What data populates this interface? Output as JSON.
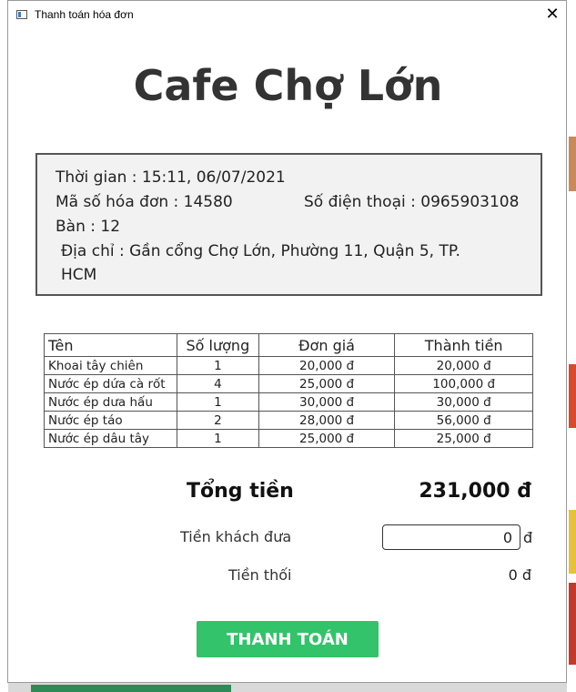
{
  "window": {
    "title": "Thanh toán hóa đơn",
    "close_glyph": "✕"
  },
  "shop": {
    "name": "Cafe Chợ Lớn"
  },
  "info": {
    "time": "Thời gian : 15:11, 06/07/2021",
    "invoice_no": "Mã số hóa đơn : 14580",
    "phone": "Số điện thoại : 0965903108",
    "table": "Bàn : 12",
    "address_line1": "Địa chỉ : Gần cổng Chợ Lớn, Phường 11, Quận 5, TP.",
    "address_line2": "HCM"
  },
  "table": {
    "headers": [
      "Tên",
      "Số lượng",
      "Đơn giá",
      "Thành tiền"
    ],
    "rows": [
      [
        "Khoai tây chiên",
        "1",
        "20,000 đ",
        "20,000 đ"
      ],
      [
        "Nước ép dứa cà rốt",
        "4",
        "25,000 đ",
        "100,000 đ"
      ],
      [
        "Nước ép dưa hấu",
        "1",
        "30,000 đ",
        "30,000 đ"
      ],
      [
        "Nước ép táo",
        "2",
        "28,000 đ",
        "56,000 đ"
      ],
      [
        "Nước ép dâu tây",
        "1",
        "25,000 đ",
        "25,000 đ"
      ]
    ]
  },
  "summary": {
    "total_label": "Tổng tiền",
    "total_value": "231,000 đ",
    "paid_label": "Tiền khách đưa",
    "paid_value": "0",
    "paid_currency": "đ",
    "change_label": "Tiền thối",
    "change_value": "0 đ"
  },
  "actions": {
    "pay_label": "THANH TOÁN"
  },
  "colors": {
    "pay_button": "#33c36a",
    "info_box_bg": "#f2f2f2",
    "title_text": "#333333"
  }
}
